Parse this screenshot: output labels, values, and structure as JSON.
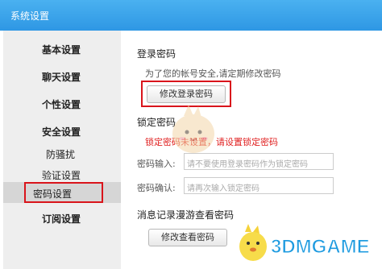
{
  "window": {
    "title": "系统设置"
  },
  "sidebar": {
    "items": [
      {
        "label": "基本设置"
      },
      {
        "label": "聊天设置"
      },
      {
        "label": "个性设置"
      },
      {
        "label": "安全设置"
      },
      {
        "label": "防骚扰"
      },
      {
        "label": "验证设置"
      },
      {
        "label": "密码设置",
        "selected": true
      },
      {
        "label": "订阅设置"
      }
    ]
  },
  "login_password": {
    "title": "登录密码",
    "hint": "为了您的帐号安全,请定期修改密码",
    "button": "修改登录密码"
  },
  "lock_password": {
    "title": "锁定密码",
    "warning": "锁定密码未设置，请设置锁定密码",
    "input_label": "密码输入:",
    "input_placeholder": "请不要使用登录密码作为锁定密码",
    "confirm_label": "密码确认:",
    "confirm_placeholder": "请再次输入锁定密码"
  },
  "roaming_password": {
    "title": "消息记录漫游查看密码",
    "button": "修改查看密码"
  },
  "watermark": {
    "text": "3DMGAME"
  },
  "colors": {
    "titlebar": "#3aa4ea",
    "highlight": "#d9141b",
    "warning": "#e02020",
    "watermark": "#1e9be0"
  }
}
